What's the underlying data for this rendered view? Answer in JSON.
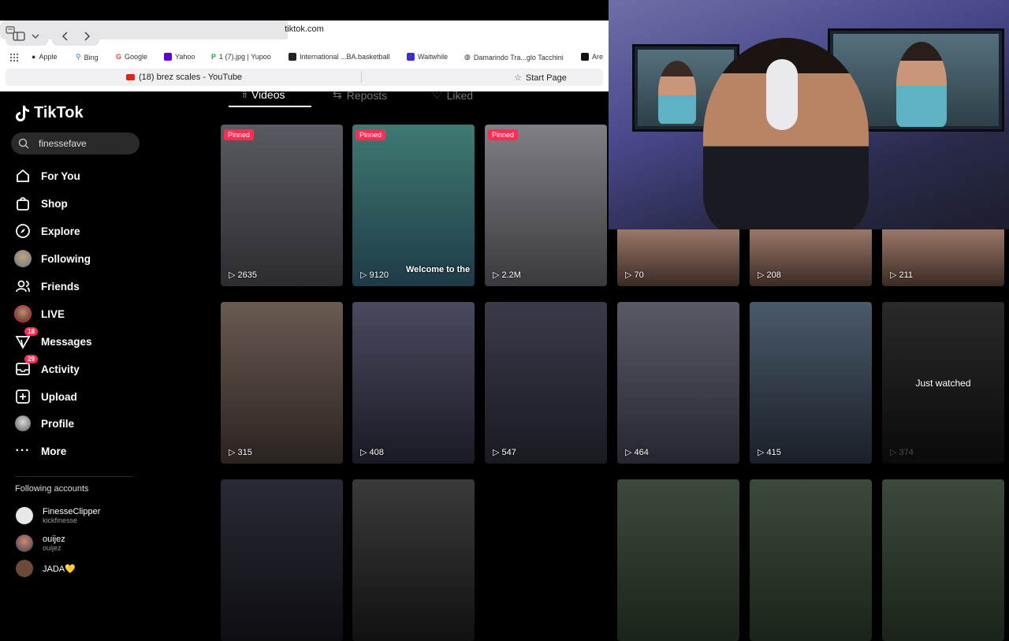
{
  "browser": {
    "address": "tiktok.com",
    "bookmarks": [
      "Apple",
      "Bing",
      "Google",
      "Yahoo",
      "1 (7).jpg | Yupoo",
      "International ...BA.basketball",
      "Waitwhile",
      "Damarindo Tra...glo Tacchini",
      "Are"
    ],
    "tabs": [
      {
        "label": "(18) brez scales - YouTube"
      },
      {
        "label": "Start Page"
      }
    ]
  },
  "tiktok": {
    "logo": "TikTok",
    "search_value": "finessefave",
    "nav": [
      {
        "label": "For You",
        "icon": "home-icon"
      },
      {
        "label": "Shop",
        "icon": "shopping-bag-icon"
      },
      {
        "label": "Explore",
        "icon": "compass-icon"
      },
      {
        "label": "Following",
        "icon": "avatar-icon"
      },
      {
        "label": "Friends",
        "icon": "friends-icon"
      },
      {
        "label": "LIVE",
        "icon": "live-avatar-icon"
      },
      {
        "label": "Messages",
        "icon": "send-icon",
        "badge": "18"
      },
      {
        "label": "Activity",
        "icon": "inbox-icon",
        "badge": "29"
      },
      {
        "label": "Upload",
        "icon": "plus-square-icon"
      },
      {
        "label": "Profile",
        "icon": "profile-icon"
      },
      {
        "label": "More",
        "icon": "more-icon"
      }
    ],
    "following_title": "Following accounts",
    "accounts": [
      {
        "name": "FinesseClipper",
        "handle": "kickfinesse"
      },
      {
        "name": "ouijez",
        "handle": "ouijez"
      },
      {
        "name": "JADA💛",
        "handle": ""
      }
    ]
  },
  "profile_tabs": [
    "Videos",
    "Reposts",
    "Liked"
  ],
  "videos": [
    {
      "pinned": "Pinned",
      "views": "2635",
      "caption": ""
    },
    {
      "pinned": "Pinned",
      "views": "9120",
      "caption": "Welcome to the"
    },
    {
      "pinned": "Pinned",
      "views": "2.2M",
      "caption": ""
    },
    {
      "pinned": "",
      "views": "70",
      "caption": ""
    },
    {
      "pinned": "",
      "views": "208",
      "caption": ""
    },
    {
      "pinned": "",
      "views": "211",
      "caption": ""
    },
    {
      "pinned": "",
      "views": "315",
      "caption": ""
    },
    {
      "pinned": "",
      "views": "408",
      "caption": ""
    },
    {
      "pinned": "",
      "views": "547",
      "caption": ""
    },
    {
      "pinned": "",
      "views": "464",
      "caption": ""
    },
    {
      "pinned": "",
      "views": "415",
      "caption": ""
    },
    {
      "pinned": "",
      "views": "374",
      "caption": "",
      "overlay": "Just watched"
    },
    {
      "pinned": "",
      "views": "",
      "caption": ""
    },
    {
      "pinned": "",
      "views": "",
      "caption": ""
    },
    {
      "pinned": "",
      "views": "",
      "caption": ""
    },
    {
      "pinned": "",
      "views": "",
      "caption": ""
    },
    {
      "pinned": "",
      "views": "",
      "caption": ""
    },
    {
      "pinned": "",
      "views": "",
      "caption": ""
    }
  ],
  "colors": {
    "accent": "#fe2c55",
    "background": "#000000"
  }
}
